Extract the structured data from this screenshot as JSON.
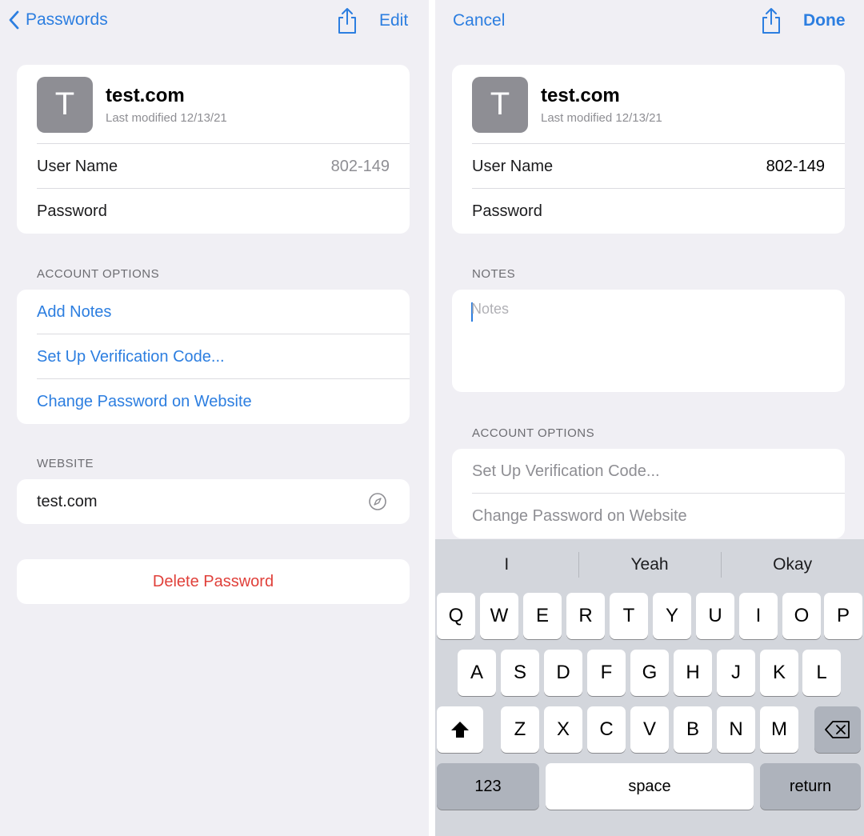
{
  "left": {
    "nav": {
      "back_label": "Passwords",
      "edit_label": "Edit"
    },
    "header": {
      "initial": "T",
      "site": "test.com",
      "modified": "Last modified 12/13/21"
    },
    "fields": [
      {
        "label": "User Name",
        "value": "802-149"
      },
      {
        "label": "Password",
        "value": ""
      }
    ],
    "account_options": {
      "title": "ACCOUNT OPTIONS",
      "items": [
        "Add Notes",
        "Set Up Verification Code...",
        "Change Password on Website"
      ]
    },
    "website": {
      "title": "WEBSITE",
      "value": "test.com"
    },
    "delete_label": "Delete Password"
  },
  "right": {
    "nav": {
      "cancel_label": "Cancel",
      "done_label": "Done"
    },
    "header": {
      "initial": "T",
      "site": "test.com",
      "modified": "Last modified 12/13/21"
    },
    "fields": [
      {
        "label": "User Name",
        "value": "802-149"
      },
      {
        "label": "Password",
        "value": ""
      }
    ],
    "notes": {
      "title": "NOTES",
      "placeholder": "Notes",
      "value": ""
    },
    "account_options": {
      "title": "ACCOUNT OPTIONS",
      "items": [
        "Set Up Verification Code...",
        "Change Password on Website"
      ]
    }
  },
  "keyboard": {
    "suggestions": [
      "I",
      "Yeah",
      "Okay"
    ],
    "row1": [
      "Q",
      "W",
      "E",
      "R",
      "T",
      "Y",
      "U",
      "I",
      "O",
      "P"
    ],
    "row2": [
      "A",
      "S",
      "D",
      "F",
      "G",
      "H",
      "J",
      "K",
      "L"
    ],
    "row3": [
      "Z",
      "X",
      "C",
      "V",
      "B",
      "N",
      "M"
    ],
    "numbers_label": "123",
    "space_label": "space",
    "return_label": "return"
  },
  "colors": {
    "accent": "#2c7ee0",
    "destructive": "#e0403a",
    "background": "#f0eff4"
  },
  "icons": [
    "chevron-left-icon",
    "share-icon",
    "compass-icon",
    "shift-icon",
    "delete-backspace-icon"
  ]
}
